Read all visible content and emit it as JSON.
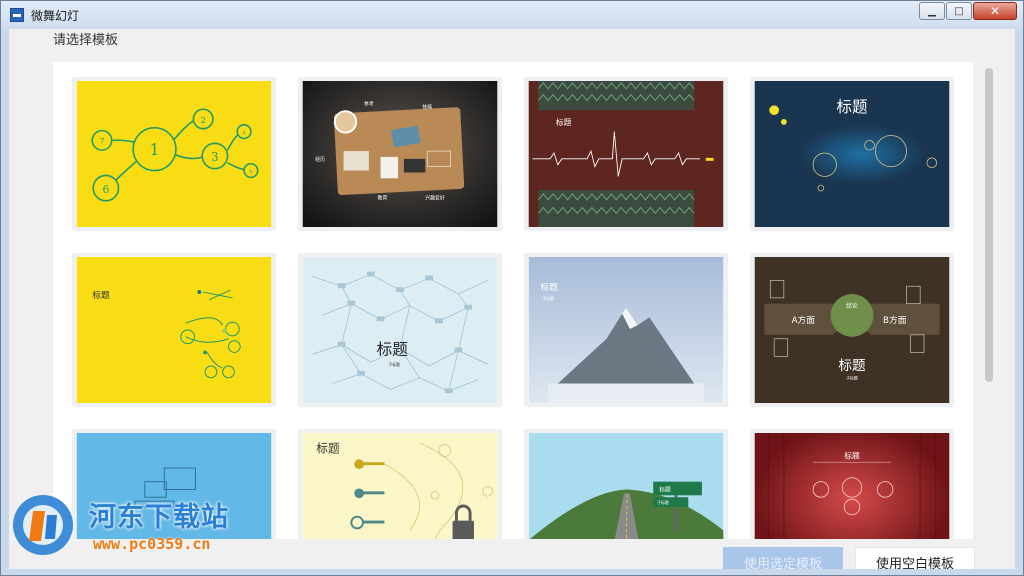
{
  "window": {
    "title": "微舞幻灯",
    "minimize": "▁",
    "maximize": "□",
    "close": "✕"
  },
  "prompt": "请选择模板",
  "templates": [
    {
      "style": "yellow-circles",
      "numbers": [
        "1",
        "2",
        "3",
        "7",
        "6",
        "4",
        "5"
      ]
    },
    {
      "style": "wood-desk",
      "labels": [
        "参考",
        "技能",
        "经历",
        "教育",
        "兴趣爱好"
      ]
    },
    {
      "style": "heartbeat",
      "title": "标题"
    },
    {
      "style": "night-bubbles",
      "title": "标题"
    },
    {
      "style": "yellow-branches",
      "title": "标题"
    },
    {
      "style": "network",
      "title": "标题",
      "subtitle": "子标题"
    },
    {
      "style": "mountain",
      "title": "标题",
      "subtitle": "子标题"
    },
    {
      "style": "arrows",
      "center": "结论",
      "left": "A方面",
      "right": "B方面",
      "title": "标题",
      "subtitle": "子标题"
    },
    {
      "style": "blue-screens"
    },
    {
      "style": "keys",
      "title": "标题"
    },
    {
      "style": "road",
      "sign": "标题",
      "sign_sub": "子标题"
    },
    {
      "style": "curtain",
      "title": "标题"
    }
  ],
  "buttons": {
    "use_selected": "使用选定模板",
    "use_blank": "使用空白模板"
  },
  "watermark": {
    "site": "河东下载站",
    "url": "www.pc0359.cn"
  },
  "colors": {
    "accent": "#2a7fd4",
    "selected_button": "#a9c6ea",
    "yellow": "#f8dc14"
  }
}
